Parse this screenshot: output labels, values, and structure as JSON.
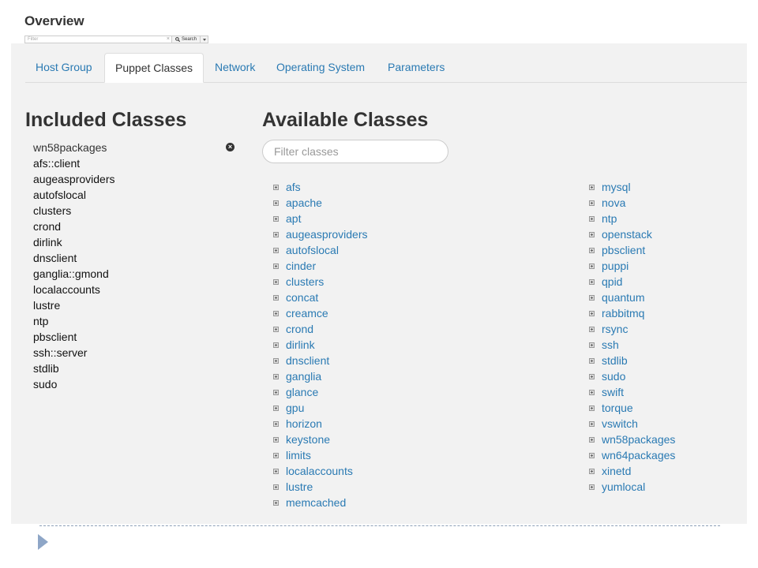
{
  "header": {
    "title": "Overview",
    "filter_placeholder": "Filter",
    "search_label": "Search",
    "clear_label": "×"
  },
  "tabs": [
    {
      "label": "Host Group"
    },
    {
      "label": "Puppet Classes",
      "active": true
    },
    {
      "label": "Network"
    },
    {
      "label": "Operating System"
    },
    {
      "label": "Parameters"
    }
  ],
  "included": {
    "heading": "Included Classes",
    "items": [
      "wn58packages",
      "afs::client",
      "augeasproviders",
      "autofslocal",
      "clusters",
      "crond",
      "dirlink",
      "dnsclient",
      "ganglia::gmond",
      "localaccounts",
      "lustre",
      "ntp",
      "pbsclient",
      "ssh::server",
      "stdlib",
      "sudo"
    ],
    "remove_icon": "remove-icon"
  },
  "available": {
    "heading": "Available Classes",
    "filter_placeholder": "Filter classes",
    "columns": [
      [
        "afs",
        "apache",
        "apt",
        "augeasproviders",
        "autofslocal",
        "cinder",
        "clusters",
        "concat",
        "creamce",
        "crond",
        "dirlink",
        "dnsclient",
        "ganglia",
        "glance",
        "gpu",
        "horizon",
        "keystone",
        "limits",
        "localaccounts",
        "lustre",
        "memcached"
      ],
      [
        "mysql",
        "nova",
        "ntp",
        "openstack",
        "pbsclient",
        "puppi",
        "qpid",
        "quantum",
        "rabbitmq",
        "rsync",
        "ssh",
        "stdlib",
        "sudo",
        "swift",
        "torque",
        "vswitch",
        "wn58packages",
        "wn64packages",
        "xinetd",
        "yumlocal"
      ]
    ],
    "item_icon": "plus-box-icon"
  },
  "colors": {
    "link": "#2a7ab3",
    "panel_bg": "#f2f2f2",
    "heading": "#333333"
  }
}
